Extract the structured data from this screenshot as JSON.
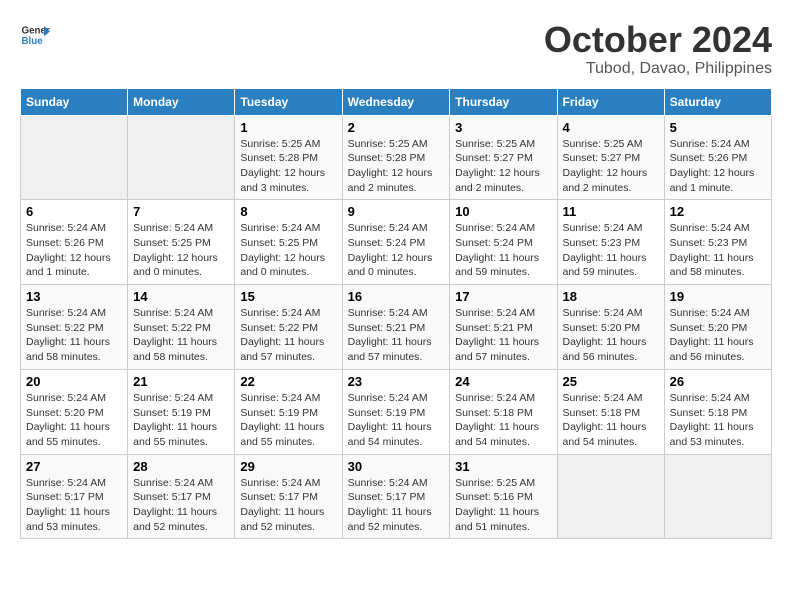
{
  "header": {
    "logo_line1": "General",
    "logo_line2": "Blue",
    "title": "October 2024",
    "subtitle": "Tubod, Davao, Philippines"
  },
  "days_of_week": [
    "Sunday",
    "Monday",
    "Tuesday",
    "Wednesday",
    "Thursday",
    "Friday",
    "Saturday"
  ],
  "weeks": [
    [
      {
        "day": null
      },
      {
        "day": null
      },
      {
        "day": 1,
        "sunrise": "5:25 AM",
        "sunset": "5:28 PM",
        "daylight": "12 hours and 3 minutes."
      },
      {
        "day": 2,
        "sunrise": "5:25 AM",
        "sunset": "5:28 PM",
        "daylight": "12 hours and 2 minutes."
      },
      {
        "day": 3,
        "sunrise": "5:25 AM",
        "sunset": "5:27 PM",
        "daylight": "12 hours and 2 minutes."
      },
      {
        "day": 4,
        "sunrise": "5:25 AM",
        "sunset": "5:27 PM",
        "daylight": "12 hours and 2 minutes."
      },
      {
        "day": 5,
        "sunrise": "5:24 AM",
        "sunset": "5:26 PM",
        "daylight": "12 hours and 1 minute."
      }
    ],
    [
      {
        "day": 6,
        "sunrise": "5:24 AM",
        "sunset": "5:26 PM",
        "daylight": "12 hours and 1 minute."
      },
      {
        "day": 7,
        "sunrise": "5:24 AM",
        "sunset": "5:25 PM",
        "daylight": "12 hours and 0 minutes."
      },
      {
        "day": 8,
        "sunrise": "5:24 AM",
        "sunset": "5:25 PM",
        "daylight": "12 hours and 0 minutes."
      },
      {
        "day": 9,
        "sunrise": "5:24 AM",
        "sunset": "5:24 PM",
        "daylight": "12 hours and 0 minutes."
      },
      {
        "day": 10,
        "sunrise": "5:24 AM",
        "sunset": "5:24 PM",
        "daylight": "11 hours and 59 minutes."
      },
      {
        "day": 11,
        "sunrise": "5:24 AM",
        "sunset": "5:23 PM",
        "daylight": "11 hours and 59 minutes."
      },
      {
        "day": 12,
        "sunrise": "5:24 AM",
        "sunset": "5:23 PM",
        "daylight": "11 hours and 58 minutes."
      }
    ],
    [
      {
        "day": 13,
        "sunrise": "5:24 AM",
        "sunset": "5:22 PM",
        "daylight": "11 hours and 58 minutes."
      },
      {
        "day": 14,
        "sunrise": "5:24 AM",
        "sunset": "5:22 PM",
        "daylight": "11 hours and 58 minutes."
      },
      {
        "day": 15,
        "sunrise": "5:24 AM",
        "sunset": "5:22 PM",
        "daylight": "11 hours and 57 minutes."
      },
      {
        "day": 16,
        "sunrise": "5:24 AM",
        "sunset": "5:21 PM",
        "daylight": "11 hours and 57 minutes."
      },
      {
        "day": 17,
        "sunrise": "5:24 AM",
        "sunset": "5:21 PM",
        "daylight": "11 hours and 57 minutes."
      },
      {
        "day": 18,
        "sunrise": "5:24 AM",
        "sunset": "5:20 PM",
        "daylight": "11 hours and 56 minutes."
      },
      {
        "day": 19,
        "sunrise": "5:24 AM",
        "sunset": "5:20 PM",
        "daylight": "11 hours and 56 minutes."
      }
    ],
    [
      {
        "day": 20,
        "sunrise": "5:24 AM",
        "sunset": "5:20 PM",
        "daylight": "11 hours and 55 minutes."
      },
      {
        "day": 21,
        "sunrise": "5:24 AM",
        "sunset": "5:19 PM",
        "daylight": "11 hours and 55 minutes."
      },
      {
        "day": 22,
        "sunrise": "5:24 AM",
        "sunset": "5:19 PM",
        "daylight": "11 hours and 55 minutes."
      },
      {
        "day": 23,
        "sunrise": "5:24 AM",
        "sunset": "5:19 PM",
        "daylight": "11 hours and 54 minutes."
      },
      {
        "day": 24,
        "sunrise": "5:24 AM",
        "sunset": "5:18 PM",
        "daylight": "11 hours and 54 minutes."
      },
      {
        "day": 25,
        "sunrise": "5:24 AM",
        "sunset": "5:18 PM",
        "daylight": "11 hours and 54 minutes."
      },
      {
        "day": 26,
        "sunrise": "5:24 AM",
        "sunset": "5:18 PM",
        "daylight": "11 hours and 53 minutes."
      }
    ],
    [
      {
        "day": 27,
        "sunrise": "5:24 AM",
        "sunset": "5:17 PM",
        "daylight": "11 hours and 53 minutes."
      },
      {
        "day": 28,
        "sunrise": "5:24 AM",
        "sunset": "5:17 PM",
        "daylight": "11 hours and 52 minutes."
      },
      {
        "day": 29,
        "sunrise": "5:24 AM",
        "sunset": "5:17 PM",
        "daylight": "11 hours and 52 minutes."
      },
      {
        "day": 30,
        "sunrise": "5:24 AM",
        "sunset": "5:17 PM",
        "daylight": "11 hours and 52 minutes."
      },
      {
        "day": 31,
        "sunrise": "5:25 AM",
        "sunset": "5:16 PM",
        "daylight": "11 hours and 51 minutes."
      },
      {
        "day": null
      },
      {
        "day": null
      }
    ]
  ]
}
